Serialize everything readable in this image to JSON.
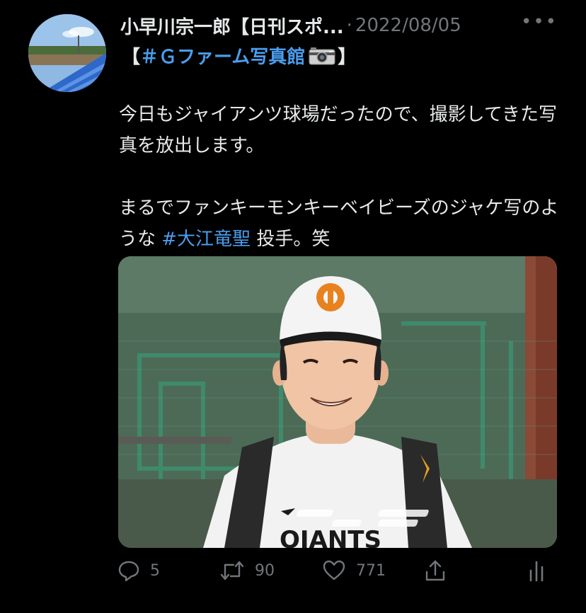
{
  "tweet": {
    "author_name": "小早川宗一郎【日刊スポ...",
    "separator": "·",
    "date": "2022/08/05",
    "more_label": "•••",
    "title_open": "【",
    "title_hashtag": "＃Ｇファーム写真館",
    "title_close": "】",
    "paragraph1": "今日もジャイアンツ球場だったので、撮影してきた写真を放出します。",
    "paragraph2_pre": "まるでファンキーモンキーベイビーズのジャケ写のような ",
    "paragraph2_hashtag": "#大江竜聖",
    "paragraph2_post": " 投手。笑"
  },
  "actions": {
    "replies": "5",
    "retweets": "90",
    "likes": "771"
  },
  "colors": {
    "background": "#000000",
    "text": "#e7e9ea",
    "muted": "#71767b",
    "link": "#4a9ded"
  }
}
